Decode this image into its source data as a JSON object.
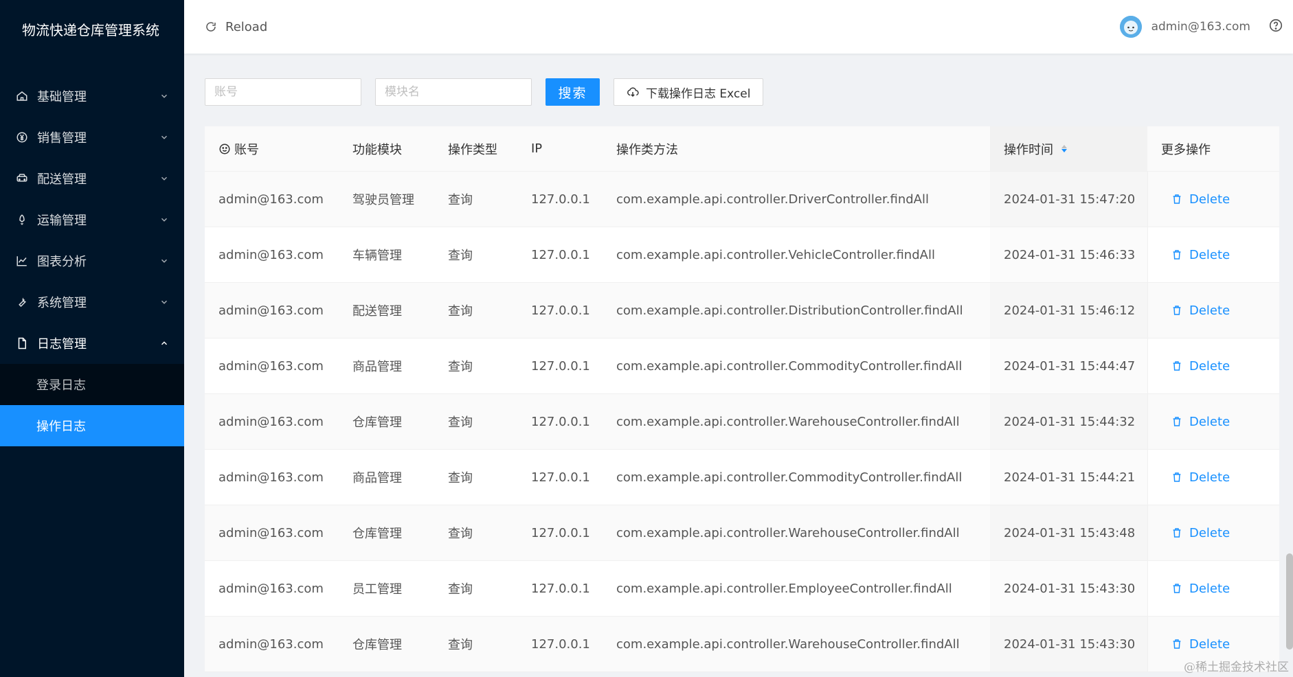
{
  "app": {
    "title": "物流快递仓库管理系统"
  },
  "sidebar": {
    "items": [
      {
        "label": "基础管理",
        "icon": "home-icon"
      },
      {
        "label": "销售管理",
        "icon": "yen-icon"
      },
      {
        "label": "配送管理",
        "icon": "car-icon"
      },
      {
        "label": "运输管理",
        "icon": "rocket-icon"
      },
      {
        "label": "图表分析",
        "icon": "chart-icon"
      },
      {
        "label": "系统管理",
        "icon": "tool-icon"
      },
      {
        "label": "日志管理",
        "icon": "file-icon"
      }
    ],
    "sub_items": [
      {
        "label": "登录日志"
      },
      {
        "label": "操作日志"
      }
    ],
    "active_sub": "操作日志"
  },
  "header": {
    "reload_label": "Reload",
    "user_email": "admin@163.com"
  },
  "filters": {
    "account_placeholder": "账号",
    "module_placeholder": "模块名",
    "search_label": "搜索",
    "download_label": "下载操作日志 Excel"
  },
  "table": {
    "columns": [
      "账号",
      "功能模块",
      "操作类型",
      "IP",
      "操作类方法",
      "操作时间",
      "更多操作"
    ],
    "rows": [
      {
        "account": "admin@163.com",
        "module": "驾驶员管理",
        "type": "查询",
        "ip": "127.0.0.1",
        "method": "com.example.api.controller.DriverController.findAll",
        "time": "2024-01-31 15:47:20",
        "action": "Delete"
      },
      {
        "account": "admin@163.com",
        "module": "车辆管理",
        "type": "查询",
        "ip": "127.0.0.1",
        "method": "com.example.api.controller.VehicleController.findAll",
        "time": "2024-01-31 15:46:33",
        "action": "Delete"
      },
      {
        "account": "admin@163.com",
        "module": "配送管理",
        "type": "查询",
        "ip": "127.0.0.1",
        "method": "com.example.api.controller.DistributionController.findAll",
        "time": "2024-01-31 15:46:12",
        "action": "Delete"
      },
      {
        "account": "admin@163.com",
        "module": "商品管理",
        "type": "查询",
        "ip": "127.0.0.1",
        "method": "com.example.api.controller.CommodityController.findAll",
        "time": "2024-01-31 15:44:47",
        "action": "Delete"
      },
      {
        "account": "admin@163.com",
        "module": "仓库管理",
        "type": "查询",
        "ip": "127.0.0.1",
        "method": "com.example.api.controller.WarehouseController.findAll",
        "time": "2024-01-31 15:44:32",
        "action": "Delete"
      },
      {
        "account": "admin@163.com",
        "module": "商品管理",
        "type": "查询",
        "ip": "127.0.0.1",
        "method": "com.example.api.controller.CommodityController.findAll",
        "time": "2024-01-31 15:44:21",
        "action": "Delete"
      },
      {
        "account": "admin@163.com",
        "module": "仓库管理",
        "type": "查询",
        "ip": "127.0.0.1",
        "method": "com.example.api.controller.WarehouseController.findAll",
        "time": "2024-01-31 15:43:48",
        "action": "Delete"
      },
      {
        "account": "admin@163.com",
        "module": "员工管理",
        "type": "查询",
        "ip": "127.0.0.1",
        "method": "com.example.api.controller.EmployeeController.findAll",
        "time": "2024-01-31 15:43:30",
        "action": "Delete"
      },
      {
        "account": "admin@163.com",
        "module": "仓库管理",
        "type": "查询",
        "ip": "127.0.0.1",
        "method": "com.example.api.controller.WarehouseController.findAll",
        "time": "2024-01-31 15:43:30",
        "action": "Delete"
      }
    ]
  },
  "watermark": "@稀土掘金技术社区",
  "colors": {
    "sidebar_bg": "#001529",
    "submenu_bg": "#000c17",
    "primary": "#1890ff",
    "page_bg": "#f0f2f5"
  }
}
